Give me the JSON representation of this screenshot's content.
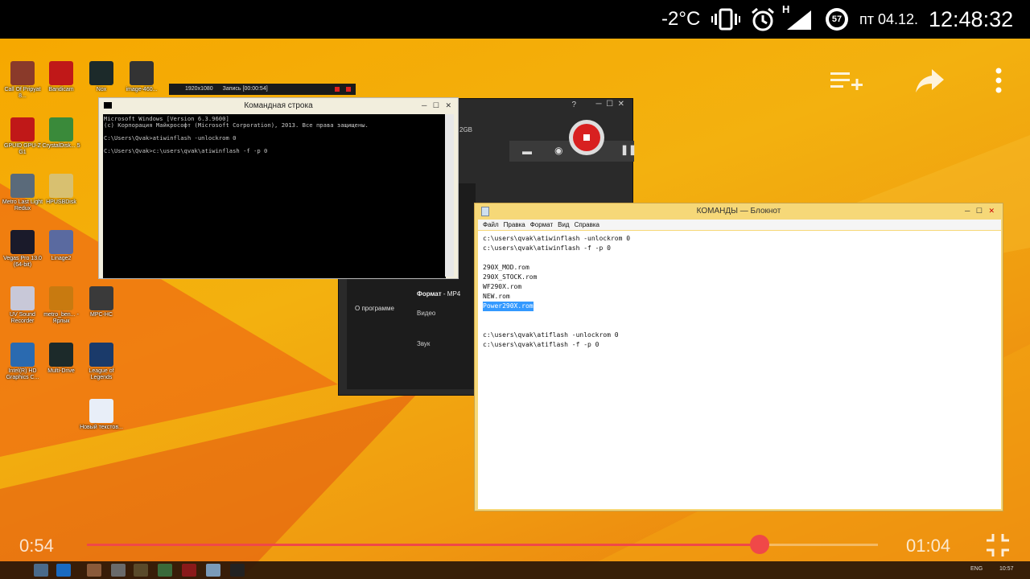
{
  "status_bar": {
    "temperature": "-2°C",
    "battery_level": "57",
    "date": "пт 04.12.",
    "time": "12:48:32",
    "network_label": "H"
  },
  "recorder_bar": {
    "resolution": "1920x1080",
    "record_label": "Запись [00:00:54]"
  },
  "desktop_icons": [
    {
      "label": "Call Of Pripyat 8...",
      "color": "#8a3a2a"
    },
    {
      "label": "Bandicam",
      "color": "#c01818"
    },
    {
      "label": "Nox",
      "color": "#1c2a2a"
    },
    {
      "label": "image-460...",
      "color": "#333333"
    },
    {
      "label": "GPUID GPU-Z G1",
      "color": "#c01818"
    },
    {
      "label": "CrystalDisk... 5",
      "color": "#3a8a3a"
    },
    {
      "label": "Metro Last Light Redux",
      "color": "#5a6a7a"
    },
    {
      "label": "HPUSBDisk",
      "color": "#d8c070"
    },
    {
      "label": "Vegas Pro 13.0 (64-bit)",
      "color": "#1a1a2a"
    },
    {
      "label": "Linage2",
      "color": "#5a6aa0"
    },
    {
      "label": "UV Sound Recorder",
      "color": "#c8c8d8"
    },
    {
      "label": "metro_ben... - Ярлык",
      "color": "#c87a10"
    },
    {
      "label": "MPC-HC",
      "color": "#3a3a3a"
    },
    {
      "label": "Intel(R) HD Graphics C...",
      "color": "#2a6ab0"
    },
    {
      "label": "Multi-Drive",
      "color": "#1c2a2a"
    },
    {
      "label": "League of Legends",
      "color": "#1a3a6a"
    },
    {
      "label": "Новый текстов...",
      "color": "#e8eef8"
    }
  ],
  "cmd_window": {
    "title": "Командная строка",
    "lines": [
      "Microsoft Windows [Version 6.3.9600]",
      "(c) Корпорация Майкрософт (Microsoft Corporation), 2013. Все права защищены.",
      "",
      "C:\\Users\\Qvak>atiwinflash -unlockrom 0",
      "",
      "C:\\Users\\Qvak>c:\\users\\qvak\\atiwinflash -f -p 0"
    ]
  },
  "bandicam_window": {
    "size_text": "2GB",
    "format_label": "Формат",
    "format_value": "- MP4",
    "video_label": "Видео",
    "sound_label": "Звук",
    "about_label": "О программе",
    "help_label": "?"
  },
  "notepad": {
    "title": "КОМАНДЫ — Блокнот",
    "menu": [
      "Файл",
      "Правка",
      "Формат",
      "Вид",
      "Справка"
    ],
    "lines": [
      "c:\\users\\qvak\\atiwinflash -unlockrom 0",
      "c:\\users\\qvak\\atiwinflash -f -p 0",
      "",
      "290X_MOD.rom",
      "290X_STOCK.rom",
      "WF290X.rom",
      "NEW.rom",
      "Power290X.rom",
      "",
      "",
      "c:\\users\\qvak\\atiflash -unlockrom 0",
      "c:\\users\\qvak\\atiflash -f -p 0"
    ],
    "selected_line": "Power290X.rom"
  },
  "player": {
    "current_time": "0:54",
    "total_time": "01:04",
    "progress": 0.85,
    "colors": {
      "accent": "#f04848",
      "track": "rgba(255,255,255,0.35)"
    }
  },
  "taskbar": {
    "lang": "ENG",
    "clock": "10:57"
  }
}
